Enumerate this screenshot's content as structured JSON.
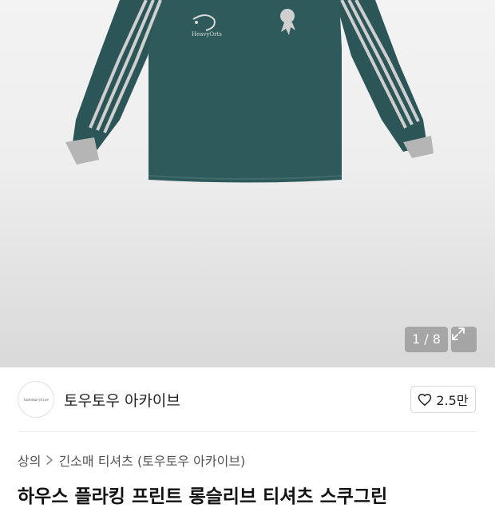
{
  "product_image": {
    "counter": "1 / 8",
    "expand_icon": "expand-arrows-icon",
    "print_left_text": "HeavyOrts",
    "shirt_color": "#2f5a5c",
    "stripe_color": "#c9c9c9",
    "cuff_color": "#b8b8b8"
  },
  "shop": {
    "name": "토우토우 아카이브",
    "avatar_text": "towtowarchive",
    "like_icon": "heart-icon",
    "like_count": "2.5만"
  },
  "breadcrumb": {
    "root": "상의",
    "separator_icon": "chevron-right-icon",
    "category": "긴소매 티셔츠 (토우토우 아카이브)"
  },
  "product": {
    "title": "하우스 플라킹 프린트 롱슬리브 티셔츠 스쿠그린"
  }
}
